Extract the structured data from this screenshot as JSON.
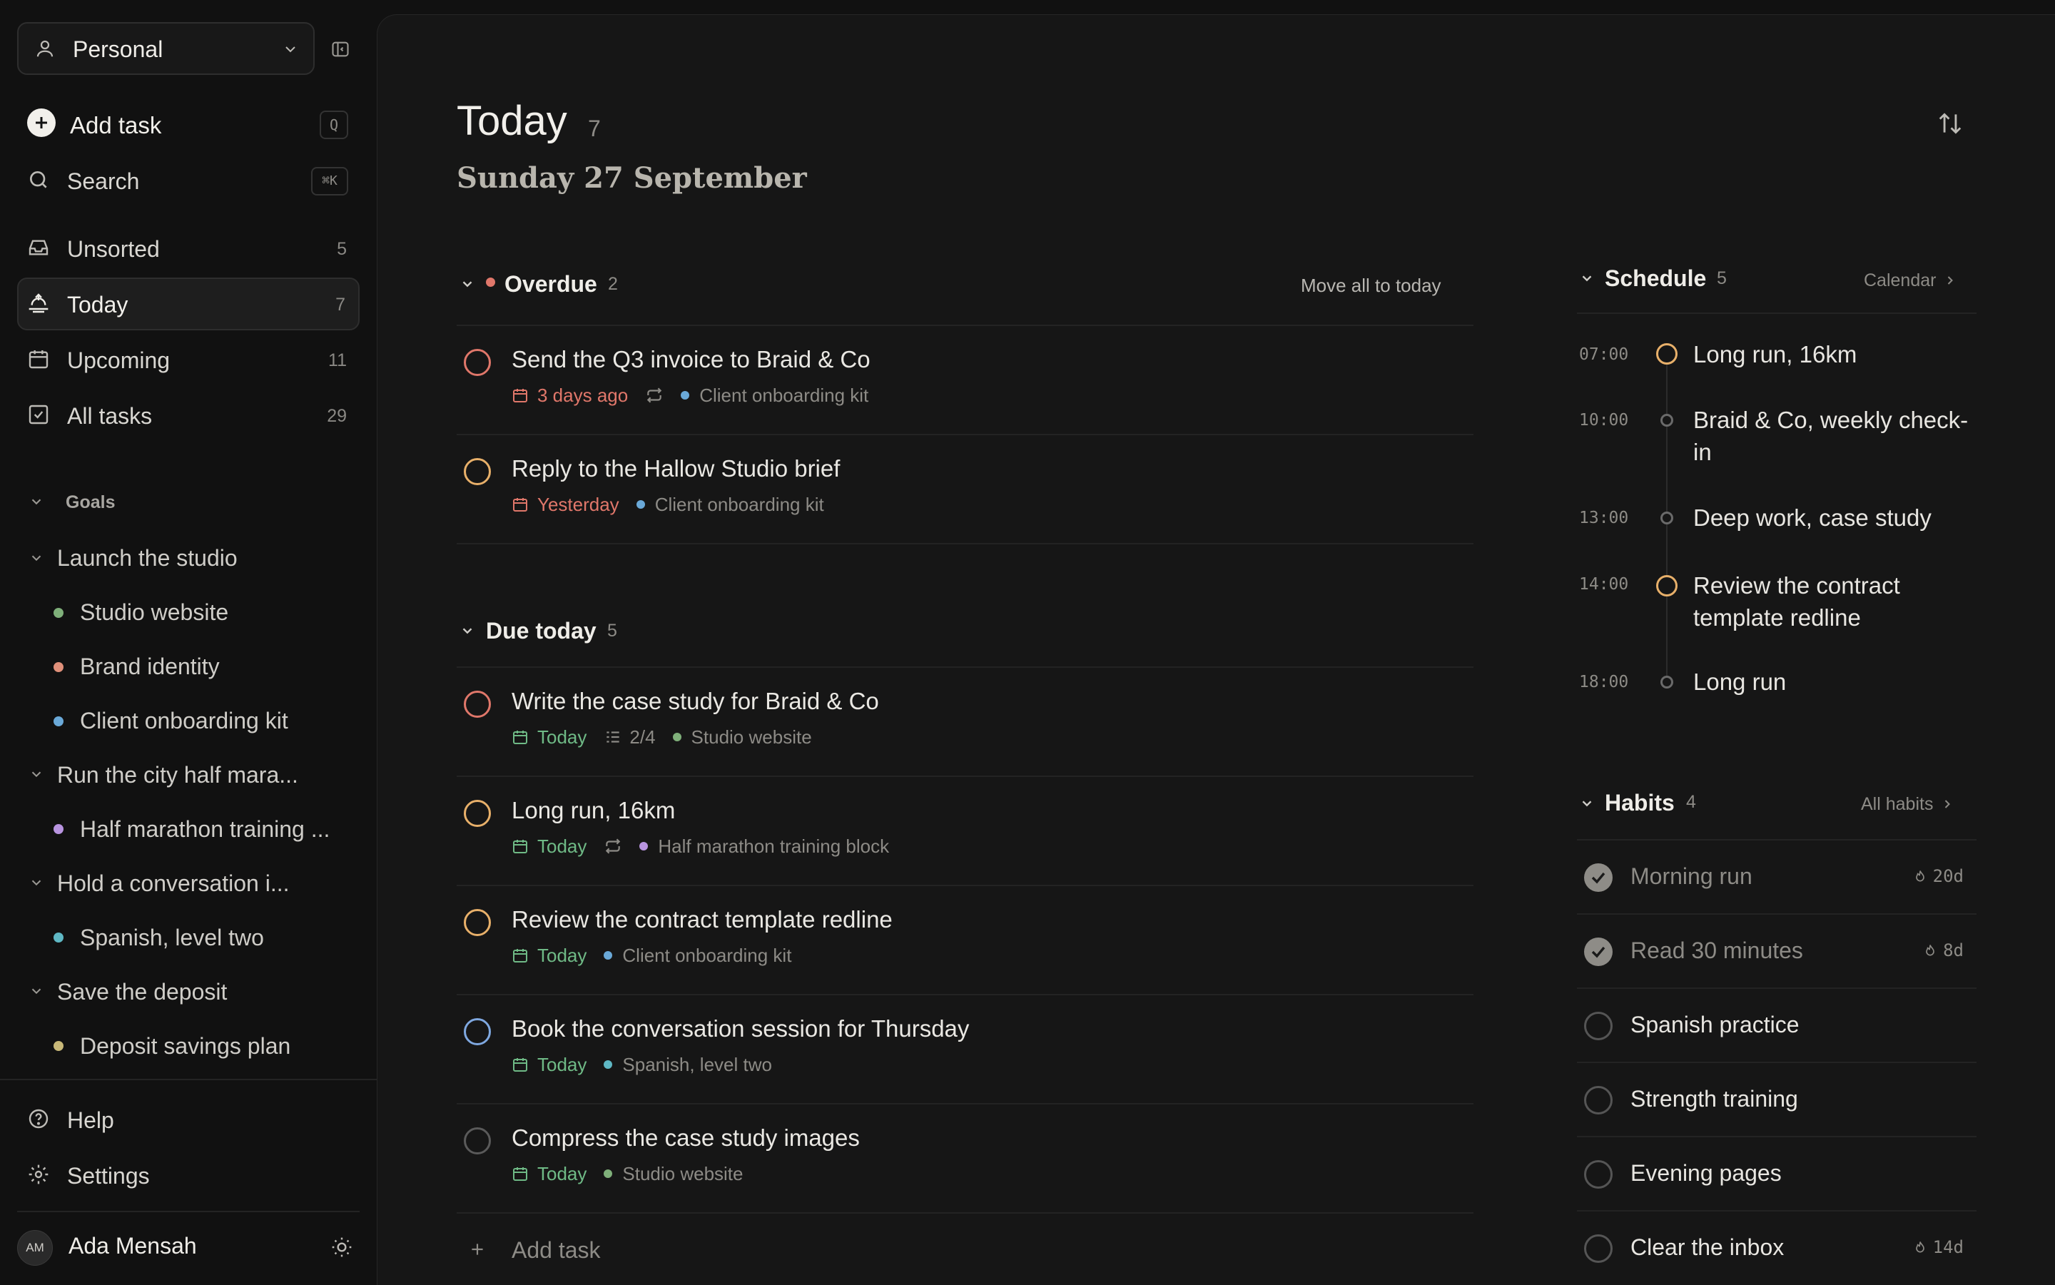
{
  "workspace": {
    "name": "Personal"
  },
  "sidebar": {
    "add_task": "Add task",
    "add_task_key": "Q",
    "search": "Search",
    "search_key": "⌘K",
    "nav": [
      {
        "label": "Unsorted",
        "count": "5"
      },
      {
        "label": "Today",
        "count": "7"
      },
      {
        "label": "Upcoming",
        "count": "11"
      },
      {
        "label": "All tasks",
        "count": "29"
      }
    ],
    "goals_heading": "Goals",
    "goals": [
      {
        "label": "Launch the studio",
        "projects": [
          {
            "label": "Studio website",
            "color": "#7fb07a"
          },
          {
            "label": "Brand identity",
            "color": "#e0907a"
          },
          {
            "label": "Client onboarding kit",
            "color": "#6aa9d8"
          }
        ]
      },
      {
        "label": "Run the city half mara...",
        "projects": [
          {
            "label": "Half marathon training ...",
            "color": "#b894e0"
          }
        ]
      },
      {
        "label": "Hold a conversation i...",
        "projects": [
          {
            "label": "Spanish, level two",
            "color": "#5fb8c4"
          }
        ]
      },
      {
        "label": "Save the deposit",
        "projects": [
          {
            "label": "Deposit savings plan",
            "color": "#c8b878"
          }
        ]
      }
    ],
    "help": "Help",
    "settings": "Settings",
    "user": {
      "initials": "AM",
      "name": "Ada Mensah"
    }
  },
  "main": {
    "title": "Today",
    "count": "7",
    "date": "Sunday 27 September",
    "overdue": {
      "label": "Overdue",
      "count": "2",
      "action": "Move all to today",
      "tasks": [
        {
          "title": "Send the Q3 invoice to Braid & Co",
          "due": "3 days ago",
          "project": "Client onboarding kit",
          "priority_color": "#e0776a",
          "recurring": true
        },
        {
          "title": "Reply to the Hallow Studio brief",
          "due": "Yesterday",
          "project": "Client onboarding kit",
          "priority_color": "#e8b06a"
        }
      ]
    },
    "due_today": {
      "label": "Due today",
      "count": "5",
      "tasks": [
        {
          "title": "Write the case study for Braid & Co",
          "due": "Today",
          "subtasks": "2/4",
          "project": "Studio website",
          "priority_color": "#e0776a"
        },
        {
          "title": "Long run, 16km",
          "due": "Today",
          "project": "Half marathon training block",
          "priority_color": "#e8b06a",
          "recurring": true
        },
        {
          "title": "Review the contract template redline",
          "due": "Today",
          "project": "Client onboarding kit",
          "priority_color": "#e8b06a"
        },
        {
          "title": "Book the conversation session for Thursday",
          "due": "Today",
          "project": "Spanish, level two",
          "priority_color": "#7fa8e0"
        },
        {
          "title": "Compress the case study images",
          "due": "Today",
          "project": "Studio website",
          "priority_color": "#6a6a6a"
        }
      ]
    },
    "add_task": "Add task",
    "colors": {
      "overdue": "#e0776a",
      "today": "#6fba86",
      "accent_amber": "#e8b06a"
    }
  },
  "schedule": {
    "label": "Schedule",
    "count": "5",
    "link": "Calendar",
    "items": [
      {
        "time": "07:00",
        "title": "Long run, 16km",
        "task": true
      },
      {
        "time": "10:00",
        "title": "Braid & Co, weekly check-in",
        "task": false
      },
      {
        "time": "13:00",
        "title": "Deep work, case study",
        "task": false
      },
      {
        "time": "14:00",
        "title": "Review the contract template redline",
        "task": true
      },
      {
        "time": "18:00",
        "title": "Long run",
        "task": false
      }
    ]
  },
  "habits": {
    "label": "Habits",
    "count": "4",
    "link": "All habits",
    "items": [
      {
        "title": "Morning run",
        "done": true,
        "streak": "20d"
      },
      {
        "title": "Read 30 minutes",
        "done": true,
        "streak": "8d"
      },
      {
        "title": "Spanish practice",
        "done": false,
        "streak": ""
      },
      {
        "title": "Strength training",
        "done": false,
        "streak": ""
      },
      {
        "title": "Evening pages",
        "done": false,
        "streak": ""
      },
      {
        "title": "Clear the inbox",
        "done": false,
        "streak": "14d"
      }
    ]
  }
}
